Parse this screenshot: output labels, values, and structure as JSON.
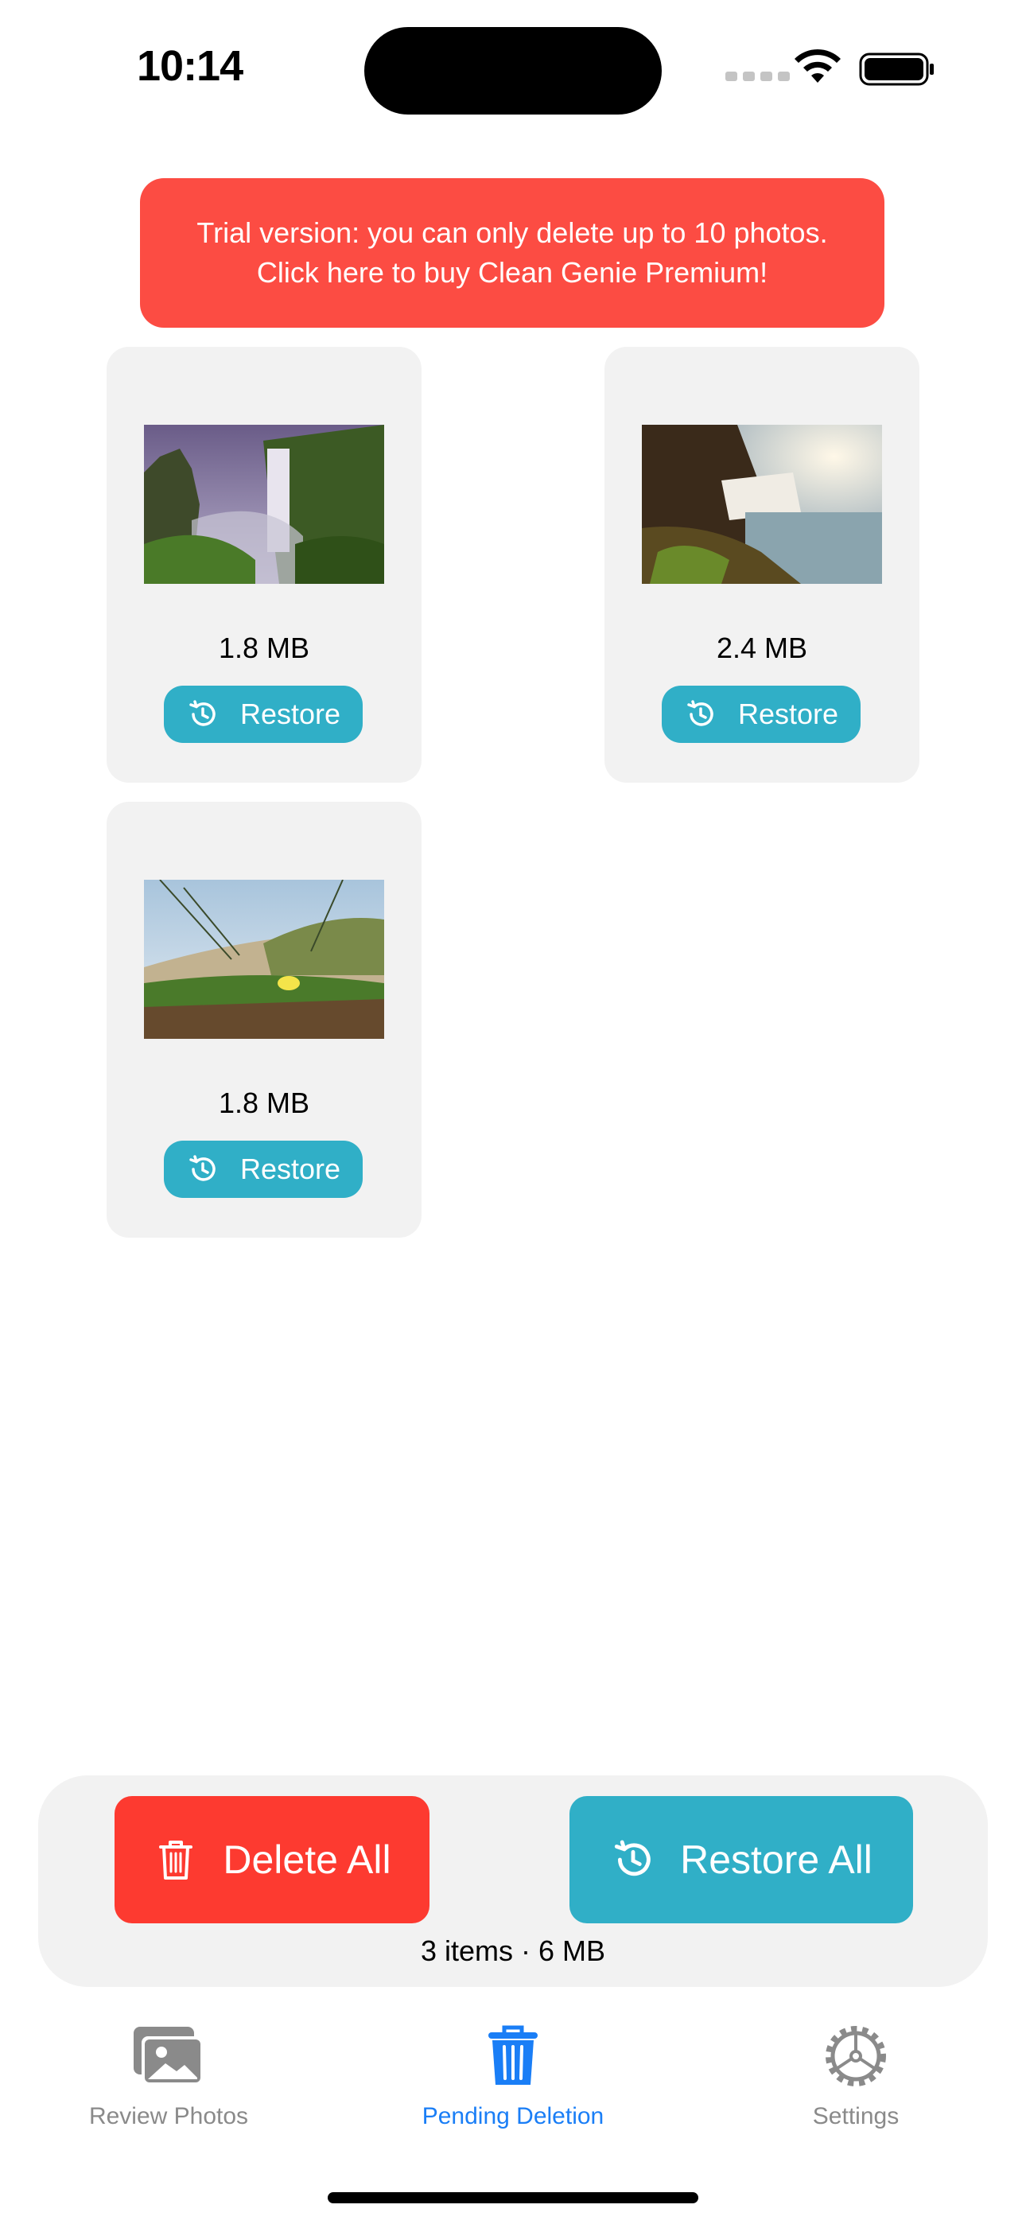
{
  "status_bar": {
    "time": "10:14"
  },
  "trial_banner": {
    "line1": "Trial version: you can only delete up to 10 photos.",
    "line2": "Click here to buy Clean Genie Premium!"
  },
  "photos": [
    {
      "size": "1.8 MB",
      "restore_label": "Restore",
      "thumbnail_icon": "waterfall-photo"
    },
    {
      "size": "2.4 MB",
      "restore_label": "Restore",
      "thumbnail_icon": "waterfall-sunlit-photo"
    },
    {
      "size": "1.8 MB",
      "restore_label": "Restore",
      "thumbnail_icon": "dune-flower-photo"
    }
  ],
  "actions": {
    "delete_all_label": "Delete All",
    "restore_all_label": "Restore All",
    "summary": "3 items · 6 MB"
  },
  "tabs": [
    {
      "label": "Review Photos",
      "icon": "photos-icon",
      "active": false
    },
    {
      "label": "Pending Deletion",
      "icon": "trash-icon",
      "active": true
    },
    {
      "label": "Settings",
      "icon": "gear-icon",
      "active": false
    }
  ],
  "colors": {
    "banner": "#fc4c43",
    "restore": "#30afc7",
    "delete": "#fd3a30",
    "active_tab": "#1a7ef6",
    "inactive_tab": "#8a8a8a"
  }
}
